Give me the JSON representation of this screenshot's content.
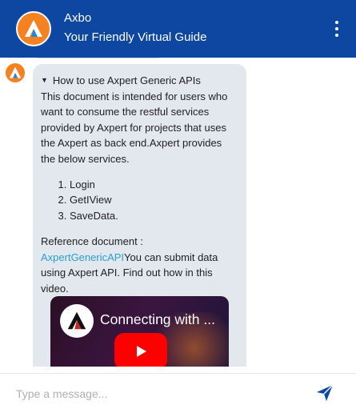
{
  "header": {
    "bot_name": "Axbo",
    "subtitle": "Your Friendly Virtual Guide",
    "logo_icon": "axbo-logo-icon",
    "menu_icon": "more-vertical-icon"
  },
  "message": {
    "summary": "How to use Axpert Generic APIs",
    "intro": "This document is intended for users who want to consume the restful services provided by Axpert for projects that uses the Axpert as back end.Axpert provides the below services.",
    "services": [
      "Login",
      "GetIView",
      "SaveData."
    ],
    "reference_label": "Reference document :",
    "reference_link": "AxpertGenericAPI",
    "video_prompt": "You can submit data using Axpert API. Find out how in this video.",
    "video": {
      "title": "Connecting with ...",
      "play_icon": "play-icon"
    }
  },
  "composer": {
    "placeholder": "Type a message...",
    "value": "",
    "send_icon": "send-icon"
  },
  "colors": {
    "header_bg": "#0d47a1",
    "brand_orange": "#f58220",
    "bubble_bg": "#e3e7ee",
    "link": "#2a9ed6",
    "send": "#0d47a1"
  }
}
